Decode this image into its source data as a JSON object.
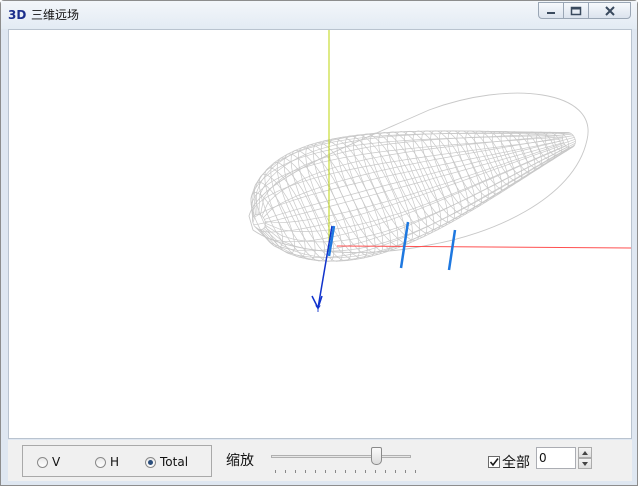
{
  "window": {
    "icon_text": "3D",
    "title": "三维远场"
  },
  "controls": {
    "radios": [
      {
        "label": "V",
        "checked": false
      },
      {
        "label": "H",
        "checked": false
      },
      {
        "label": "Total",
        "checked": true
      }
    ],
    "zoom_label": "缩放",
    "zoom_level": 0.75,
    "all_label": "全部",
    "all_checked": true,
    "spin_value": "0"
  },
  "colors": {
    "mesh": "#c8c8c8",
    "z_axis": "#bdd40d",
    "x_axis": "#ff5050",
    "y_axis": "#1133cc",
    "cut_lines": "#1e78e0"
  }
}
